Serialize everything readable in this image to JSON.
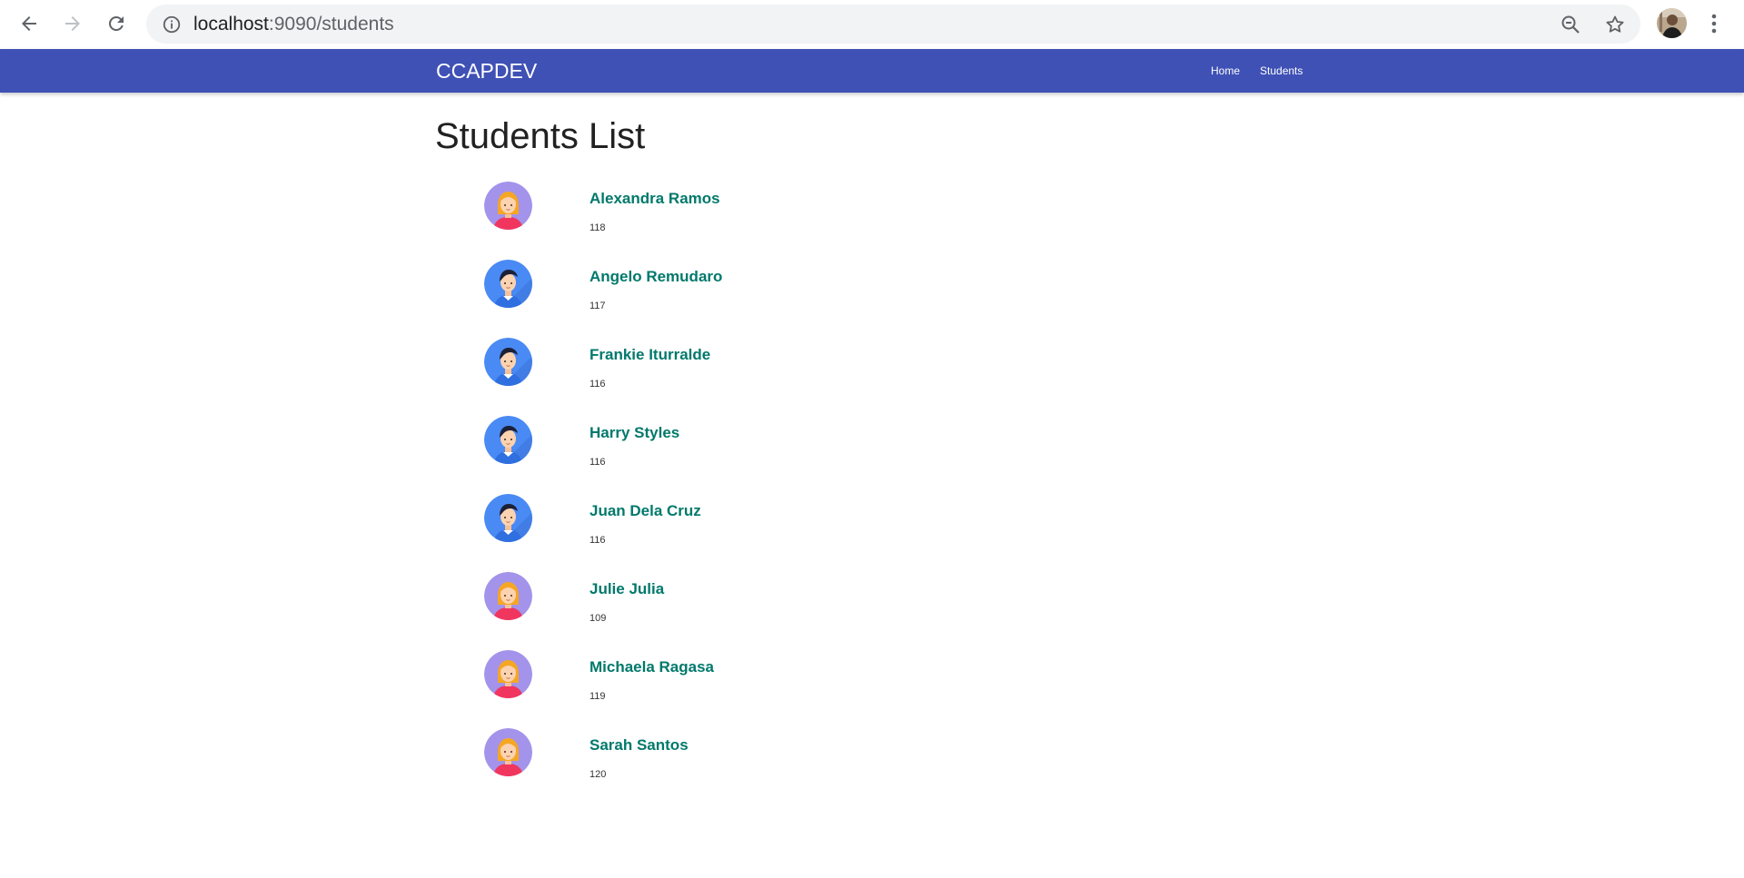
{
  "browser": {
    "url_host": "localhost",
    "url_path": ":9090/students",
    "icons": {
      "back": "arrow-left-icon",
      "forward": "arrow-right-icon",
      "reload": "reload-icon",
      "site_info": "info-icon",
      "zoom": "zoom-out-icon",
      "bookmark": "star-icon",
      "menu": "kebab-menu-icon"
    }
  },
  "navbar": {
    "brand": "CCAPDEV",
    "links": [
      "Home",
      "Students"
    ],
    "color": "#3f51b5"
  },
  "page": {
    "title": "Students List"
  },
  "students": [
    {
      "name": "Alexandra Ramos",
      "id": "118",
      "avatar": "female"
    },
    {
      "name": "Angelo Remudaro",
      "id": "117",
      "avatar": "male"
    },
    {
      "name": "Frankie Iturralde",
      "id": "116",
      "avatar": "male"
    },
    {
      "name": "Harry Styles",
      "id": "116",
      "avatar": "male"
    },
    {
      "name": "Juan Dela Cruz",
      "id": "116",
      "avatar": "male"
    },
    {
      "name": "Julie Julia",
      "id": "109",
      "avatar": "female"
    },
    {
      "name": "Michaela Ragasa",
      "id": "119",
      "avatar": "female"
    },
    {
      "name": "Sarah Santos",
      "id": "120",
      "avatar": "female"
    }
  ],
  "colors": {
    "name_link": "#00796b",
    "female_avatar_bg": "#a393eb",
    "male_avatar_bg": "#4a8af4"
  }
}
